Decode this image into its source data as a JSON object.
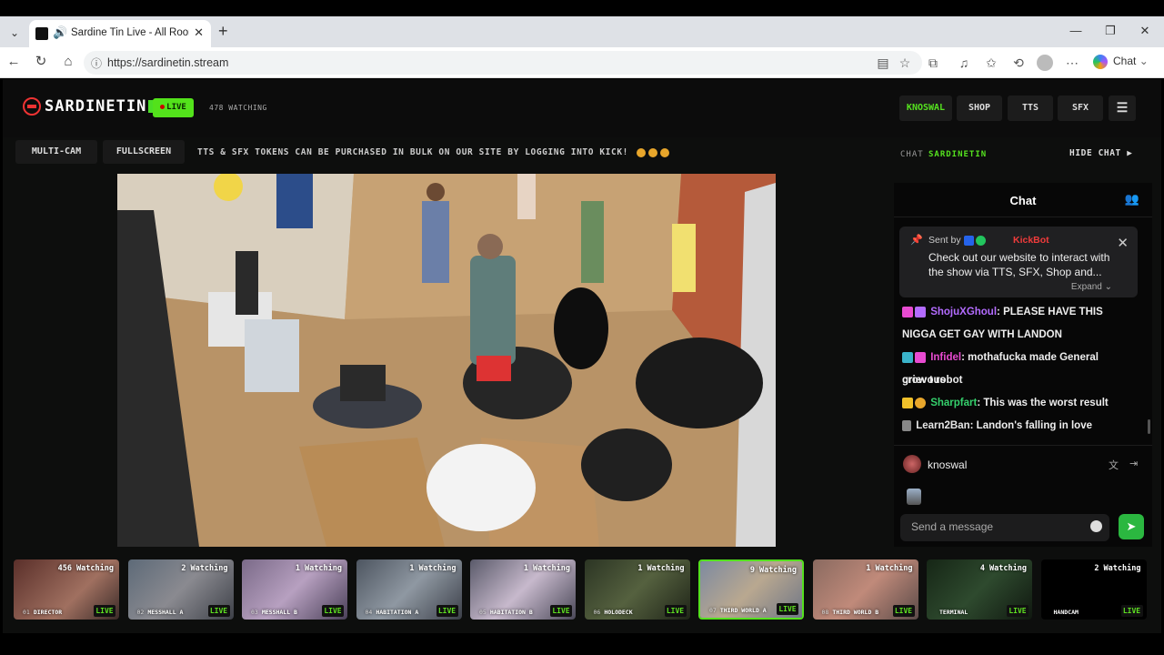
{
  "browser": {
    "tab_title": "Sardine Tin Live - All Rooms, /",
    "url": "https://sardinetin.stream",
    "copilot_label": "Chat",
    "icons": [
      "back-icon",
      "refresh-icon",
      "home-icon",
      "star-icon",
      "extensions-icon",
      "history-icon",
      "more-icon"
    ]
  },
  "header": {
    "brand": "SARDINETIN",
    "live_label": "LIVE",
    "watching": "478 WATCHING",
    "user_button": "KNOSWAL",
    "shop_button": "SHOP",
    "tts_button": "TTS",
    "sfx_button": "SFX"
  },
  "subbar": {
    "multicam": "MULTI-CAM",
    "fullscreen": "FULLSCREEN",
    "ticker": "TTS & SFX TOKENS CAN BE PURCHASED IN BULK ON OUR SITE BY LOGGING INTO KICK!"
  },
  "chat": {
    "label": "CHAT",
    "channel": "SARDINETIN",
    "hide": "HIDE CHAT ▶",
    "title": "Chat",
    "pinned": {
      "sent_by": "Sent by",
      "bot": "KickBot",
      "message": "Check out our website to interact with the show via TTS, SFX, Shop and...",
      "expand": "Expand"
    },
    "messages": [
      {
        "user": "ShojuXGhoul",
        "color": "#b36bff",
        "text": "PLEASE HAVE THIS"
      },
      {
        "user": "",
        "color": "",
        "text": "NIGGA GET GAY WITH LANDON"
      },
      {
        "user": "Infidel",
        "color": "#e84bd1",
        "text": "mothafucka made General grievous"
      },
      {
        "user": "",
        "color": "",
        "text": "crow t robot"
      },
      {
        "user": "Sharpfart",
        "color": "#35d06c",
        "text": "This was the worst result"
      },
      {
        "user": "Learn2Ban",
        "color": "#e6e6e6",
        "text": "Landon's falling in love"
      }
    ],
    "me": "knoswal",
    "input_placeholder": "Send a message"
  },
  "cameras": [
    {
      "watching": "456 Watching",
      "num": "01",
      "name": "DIRECTOR",
      "live": "LIVE"
    },
    {
      "watching": "2 Watching",
      "num": "02",
      "name": "MESSHALL A",
      "live": "LIVE"
    },
    {
      "watching": "1 Watching",
      "num": "03",
      "name": "MESSHALL B",
      "live": "LIVE"
    },
    {
      "watching": "1 Watching",
      "num": "04",
      "name": "HABITATION A",
      "live": "LIVE"
    },
    {
      "watching": "1 Watching",
      "num": "05",
      "name": "HABITATION B",
      "live": "LIVE"
    },
    {
      "watching": "1 Watching",
      "num": "06",
      "name": "HOLODECK",
      "live": "LIVE"
    },
    {
      "watching": "9 Watching",
      "num": "07",
      "name": "THIRD WORLD A",
      "live": "LIVE"
    },
    {
      "watching": "1 Watching",
      "num": "08",
      "name": "THIRD WORLD B",
      "live": "LIVE"
    },
    {
      "watching": "4 Watching",
      "num": "",
      "name": "TERMINAL",
      "live": "LIVE"
    },
    {
      "watching": "2 Watching",
      "num": "",
      "name": "HANDCAM",
      "live": "LIVE"
    }
  ],
  "colors": {
    "accent": "#55e11f",
    "bot": "#ef3b3b",
    "send": "#2bb740"
  }
}
